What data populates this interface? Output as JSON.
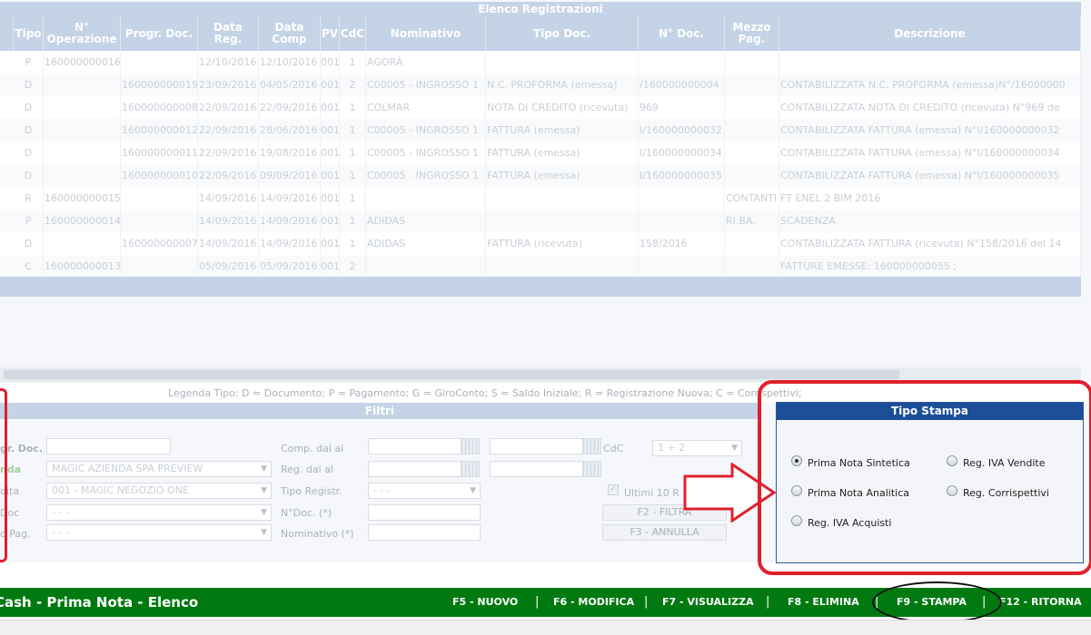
{
  "registrations": {
    "title": "Elenco Registrazioni",
    "columns": [
      "Tipo",
      "N° Operazione",
      "Progr. Doc.",
      "Data Reg.",
      "Data Comp",
      "PV",
      "CdC",
      "Nominativo",
      "Tipo Doc.",
      "N° Doc.",
      "Mezzo Pag.",
      "Descrizione"
    ],
    "rows": [
      [
        "P",
        "160000000016",
        "",
        "12/10/2016",
        "12/10/2016",
        "001",
        "1",
        "AGORÀ",
        "",
        "",
        "",
        ""
      ],
      [
        "D",
        "",
        "160000000019",
        "23/09/2016",
        "04/05/2016",
        "001",
        "2",
        "C00005 - INGROSSO 1",
        "N.C. PROFORMA (emessa)",
        "/160000000004",
        "",
        "CONTABILIZZATA N.C. PROFORMA (emessa)N°/16000000"
      ],
      [
        "D",
        "",
        "160000000008",
        "22/09/2016",
        "22/09/2016",
        "001",
        "1",
        "COLMAR",
        "NOTA DI CREDITO (ricevuta)",
        "969",
        "",
        "CONTABILIZZATA NOTA DI CREDITO (ricevuta) N°969 de"
      ],
      [
        "D",
        "",
        "160000000012",
        "22/09/2016",
        "28/06/2016",
        "001",
        "1",
        "C00005 - INGROSSO 1",
        "FATTURA (emessa)",
        "I/160000000032",
        "",
        "CONTABILIZZATA FATTURA (emessa) N°I/160000000032"
      ],
      [
        "D",
        "",
        "160000000011",
        "22/09/2016",
        "19/08/2016",
        "001",
        "1",
        "C00005 - INGROSSO 1",
        "FATTURA (emessa)",
        "I/160000000034",
        "",
        "CONTABILIZZATA FATTURA (emessa) N°I/160000000034"
      ],
      [
        "D",
        "",
        "160000000010",
        "22/09/2016",
        "09/09/2016",
        "001",
        "1",
        "C00005 - INGROSSO 1",
        "FATTURA (emessa)",
        "I/160000000035",
        "",
        "CONTABILIZZATA FATTURA (emessa) N°I/160000000035"
      ],
      [
        "R",
        "160000000015",
        "",
        "14/09/2016",
        "14/09/2016",
        "001",
        "1",
        "",
        "",
        "",
        "CONTANTI",
        "FT ENEL 2 BIM 2016"
      ],
      [
        "P",
        "160000000014",
        "",
        "14/09/2016",
        "14/09/2016",
        "001",
        "1",
        "ADIDAS",
        "",
        "",
        "RI.BA.",
        "SCADENZA"
      ],
      [
        "D",
        "",
        "160000000007",
        "14/09/2016",
        "14/09/2016",
        "001",
        "1",
        "ADIDAS",
        "FATTURA (ricevuta)",
        "158/2016",
        "",
        "CONTABILIZZATA FATTURA (ricevuta) N°158/2016 del 14"
      ],
      [
        "C",
        "160000000013",
        "",
        "05/09/2016",
        "05/09/2016",
        "001",
        "2",
        "",
        "",
        "",
        "",
        "FATTURE EMESSE: 160000000055 ;"
      ]
    ]
  },
  "legend": "Legenda Tipo:   D = Documento;   P = Pagamento;   G = GiroConto;   S = Saldo Iniziale;   R = Registrazione Nuova;   C = Corrispettivi;",
  "filters": {
    "title": "Filtri",
    "left_labels": [
      "gr. Doc.",
      "nda",
      "dita",
      "Doc",
      "o Pag."
    ],
    "azienda_value": "MAGIC AZIENDA SPA PREVIEW",
    "pv_value": "001 - MAGIC NEGOZIO ONE",
    "tipo_doc_value": "- - -",
    "mezzo_pag_value": "- - -",
    "comp_label": "Comp. dal al",
    "reg_label": "Reg. dal al",
    "tipo_registr_label": "Tipo Registr.",
    "tipo_registr_value": "- - -",
    "ndoc_label": "N°Doc. (*)",
    "nominativo_label": "Nominativo (*)",
    "cdc_label": "CdC",
    "cdc_value": "1 + 2",
    "ultimi_label": "Ultimi 10 R",
    "filtra_button": "F2 - FILTRA",
    "annulla_button": "F3 - ANNULLA"
  },
  "tipo_stampa": {
    "title": "Tipo Stampa",
    "options": [
      "Prima Nota Sintetica",
      "Prima Nota Analitica",
      "Reg. IVA Acquisti",
      "Reg. IVA Vendite",
      "Reg. Corrispettivi"
    ],
    "selected": "Prima Nota Sintetica"
  },
  "bottom_bar": {
    "title": "Cash - Prima Nota - Elenco",
    "keys": [
      "F5 - NUOVO",
      "F6 - MODIFICA",
      "F7 - VISUALIZZA",
      "F8 - ELIMINA",
      "F9 - STAMPA",
      "F12 - RITORNA"
    ]
  },
  "colors": {
    "accent_green": "#007a10",
    "panel_blue": "#1c4f98",
    "highlight_red": "#e0202c"
  }
}
